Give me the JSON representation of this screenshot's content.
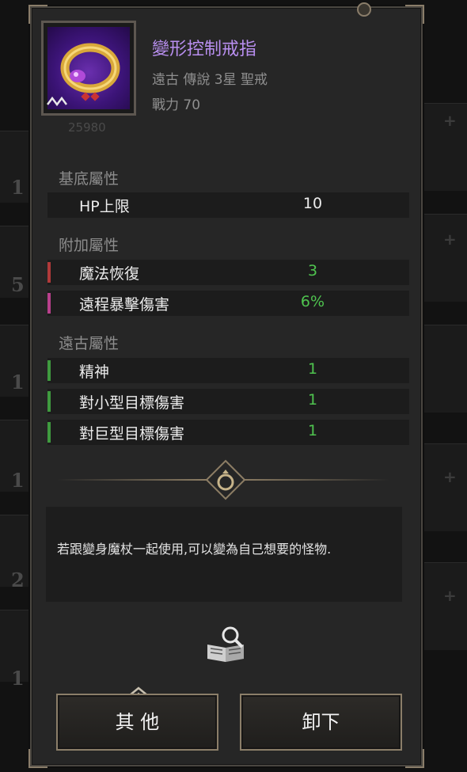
{
  "item": {
    "name": "變形控制戒指",
    "meta": "遠古 傳說 3星 聖戒",
    "power": "戰力 70",
    "power_faint": "25980"
  },
  "sections": {
    "base": "基底屬性",
    "added": "附加屬性",
    "ancient": "遠古屬性"
  },
  "base_stats": [
    {
      "name": "HP上限",
      "value": "10"
    }
  ],
  "added_stats": [
    {
      "name": "魔法恢復",
      "value": "3"
    },
    {
      "name": "遠程暴擊傷害",
      "value": "6%"
    }
  ],
  "ancient_stats": [
    {
      "name": "精神",
      "value": "1"
    },
    {
      "name": "對小型目標傷害",
      "value": "1"
    },
    {
      "name": "對巨型目標傷害",
      "value": "1"
    }
  ],
  "description": "若跟變身魔杖一起使用,可以變為自己想要的怪物.",
  "buttons": {
    "other": "其 他",
    "unequip": "卸下"
  },
  "colors": {
    "title": "#b98ff0",
    "stat_green": "#4fc44f",
    "bar_red": "#b03a3a",
    "bar_pink": "#b8408c",
    "bar_green": "#3f9a3f"
  },
  "icons": [
    "ring-item-icon",
    "ring-divider-icon",
    "book-search-icon",
    "chevron-up-icon"
  ]
}
